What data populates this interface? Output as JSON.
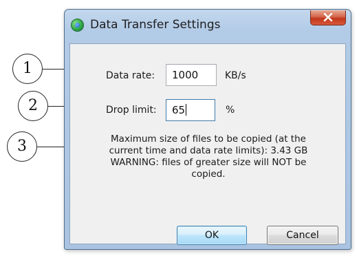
{
  "window": {
    "title": "Data Transfer Settings",
    "close_label": "x"
  },
  "fields": {
    "data_rate_label": "Data rate:",
    "data_rate_value": "1000",
    "data_rate_unit": "KB/s",
    "drop_limit_label": "Drop limit:",
    "drop_limit_value": "65",
    "drop_limit_unit": "%"
  },
  "info": {
    "line1": "Maximum size of files to be copied (at the",
    "line2": "current time and data rate limits): 3.43 GB",
    "line3": "WARNING: files of greater size will NOT be",
    "line4": "copied."
  },
  "buttons": {
    "ok": "OK",
    "cancel": "Cancel"
  },
  "callouts": [
    "1",
    "2",
    "3"
  ],
  "colors": {
    "frame": "#b2cbe7",
    "client_bg": "#f0f0f0",
    "close_button": "#c2391c",
    "ok_border": "#3c7fb1"
  },
  "icons": {
    "app": "app-logo-icon",
    "close": "close-icon"
  }
}
